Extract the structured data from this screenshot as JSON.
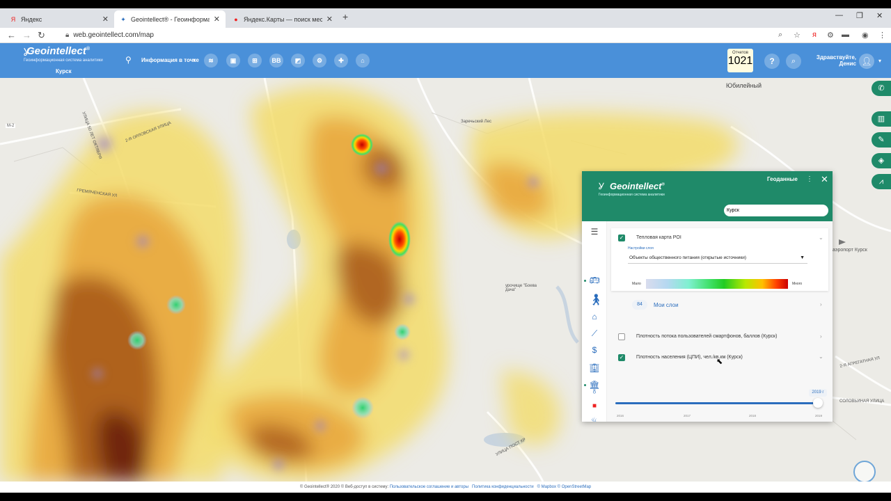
{
  "browser": {
    "tabs": [
      {
        "label": "Яндекс",
        "icon": "Я"
      },
      {
        "label": "Geointellect® - Геоинформаци",
        "icon": "✦"
      },
      {
        "label": "Яндекс.Карты — поиск мест и а",
        "icon": "●"
      }
    ],
    "url": "web.geointellect.com/map",
    "new_tab": "+",
    "close": "✕"
  },
  "header": {
    "logo": "Geointellect",
    "logo_sup": "®",
    "logo_sub": "Геоинформационная система аналитики",
    "city": "Курск",
    "info_mode": "Информация в точке",
    "tools": [
      "≋",
      "▣",
      "⊞",
      "BB",
      "◩",
      "⚙",
      "✚",
      "⌂"
    ],
    "reports_label": "Отчетов",
    "reports_count": "1021",
    "help": "?",
    "greeting": "Здравствуйте, Денис"
  },
  "map": {
    "labels": [
      {
        "text": "Юбилейный"
      },
      {
        "text": "Заречьский Лес"
      },
      {
        "text": "М-2"
      },
      {
        "text": "2-Я ОРЛОВСКАЯ УЛИЦА"
      },
      {
        "text": "УЛИЦА 50 ЛЕТ ОКТЯБРЯ"
      },
      {
        "text": "ГРЕМЯЧЕНСКАЯ УЛ"
      },
      {
        "text": "урочище \"Боева дача\""
      },
      {
        "text": "аэропорт Курск"
      },
      {
        "text": "2-Я АГРЕГАТНАЯ УЛ"
      },
      {
        "text": "СОЛОВЬИНАЯ УЛИЦА"
      },
      {
        "text": "УЛИЦА ПОСТ КР"
      }
    ]
  },
  "footer": {
    "copyright": "© Geointellect® 2020 © Веб-доступ в систему:",
    "link1": "Пользовательское соглашение и авторы",
    "link2": "Политика конфиденциальности",
    "link3": "© Mapbox © OpenStreetMap"
  },
  "panel": {
    "logo": "Geointellect",
    "logo_sub": "Геоинформационная система аналитики",
    "title": "Геоданные",
    "search_value": "Курск",
    "layer1": {
      "label": "Тепловая карта POI",
      "settings_label": "Настройки слоя",
      "select_value": "Объекты общественного питания (открытые источники)",
      "legend_min": "Мало",
      "legend_max": "Много"
    },
    "my_layers_count": "84",
    "my_layers_label": "Мои слои",
    "layer2": "Плотность потока пользователей смартфонов, баллов (Курск)",
    "layer3": "Плотность населения (ЦПИ), чел./кв.км (Курск)",
    "year_selected": "2019 г",
    "years": [
      "2016",
      "2017",
      "2018",
      "2019"
    ]
  },
  "colors": {
    "header_blue": "#4a90d9",
    "panel_green": "#1f8a69"
  }
}
